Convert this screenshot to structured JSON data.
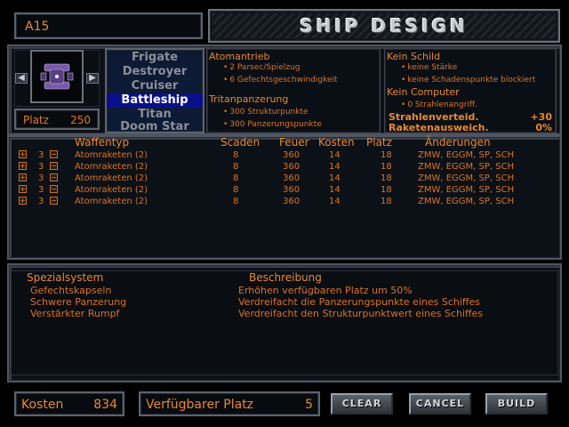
{
  "ship": {
    "name": "A15",
    "platz_label": "Platz",
    "platz_value": "250"
  },
  "title": "SHIP DESIGN",
  "classes": {
    "items": [
      "Frigate",
      "Destroyer",
      "Cruiser",
      "Battleship",
      "Titan",
      "Doom Star"
    ],
    "selected": "Battleship"
  },
  "drive": {
    "name": "Atomantrieb",
    "bullets": [
      "2 Parsec/Spielzug",
      "6 Gefechtsgeschwindigkeit"
    ],
    "armor_name": "Tritanpanzerung",
    "armor_bullets": [
      "300 Strukturpunkte",
      "300 Panzerungspunkte"
    ]
  },
  "shield": {
    "name": "Kein Schild",
    "bullets": [
      "keine Stärke",
      "keine Schadenspunkte blockiert"
    ],
    "computer_name": "Kein Computer",
    "computer_bullets": [
      "0 Strahlenangriff."
    ],
    "beam_defense_label": "Strahlenverteid.",
    "beam_defense_value": "+30",
    "missile_evasion_label": "Raketenausweich.",
    "missile_evasion_value": "0%"
  },
  "weapons": {
    "headers": {
      "type": "Waffentyp",
      "damage": "Scaden",
      "fire": "Feuer",
      "cost": "Kosten",
      "space": "Platz",
      "mods": "Änderungen"
    },
    "rows": [
      {
        "count": "3",
        "name": "Atomraketen (2)",
        "damage": "8",
        "fire": "360",
        "cost": "14",
        "space": "18",
        "mods": "ZMW, EGGM, SP, SCH"
      },
      {
        "count": "3",
        "name": "Atomraketen (2)",
        "damage": "8",
        "fire": "360",
        "cost": "14",
        "space": "18",
        "mods": "ZMW, EGGM, SP, SCH"
      },
      {
        "count": "3",
        "name": "Atomraketen (2)",
        "damage": "8",
        "fire": "360",
        "cost": "14",
        "space": "18",
        "mods": "ZMW, EGGM, SP, SCH"
      },
      {
        "count": "3",
        "name": "Atomraketen (2)",
        "damage": "8",
        "fire": "360",
        "cost": "14",
        "space": "18",
        "mods": "ZMW, EGGM, SP, SCH"
      },
      {
        "count": "3",
        "name": "Atomraketen (2)",
        "damage": "8",
        "fire": "360",
        "cost": "14",
        "space": "18",
        "mods": "ZMW, EGGM, SP, SCH"
      }
    ]
  },
  "special": {
    "header_system": "Spezialsystem",
    "header_desc": "Beschreibung",
    "rows": [
      {
        "name": "Gefechtskapseln",
        "desc": "Erhöhen verfügbaren Platz um 50%"
      },
      {
        "name": "Schwere Panzerung",
        "desc": "Verdreifacht die Panzerungspunkte eines Schiffes"
      },
      {
        "name": "Verstärkter Rumpf",
        "desc": "Verdreifacht den Strukturpunktwert eines Schiffes"
      }
    ]
  },
  "footer": {
    "cost_label": "Kosten",
    "cost_value": "834",
    "space_label": "Verfügbarer Platz",
    "space_value": "5"
  },
  "buttons": {
    "clear": "CLEAR",
    "cancel": "CANCEL",
    "build": "BUILD"
  }
}
